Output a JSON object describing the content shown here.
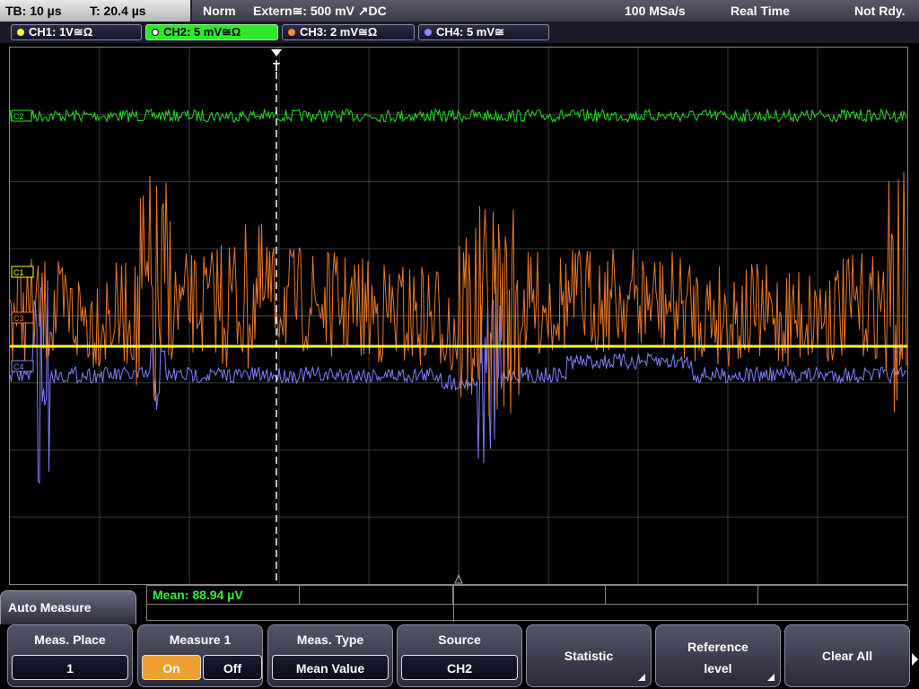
{
  "topbar": {
    "timebase": "TB: 10 µs",
    "trigger_pos": "T: 20.4 µs",
    "mode": "Norm",
    "trigger_source": "Extern≅: 500 mV ↗DC",
    "sample_rate": "100 MSa/s",
    "acq_mode": "Real Time",
    "status": "Not Rdy."
  },
  "channels": [
    {
      "label": "CH1: 1V≅Ω",
      "color": "#ffff33",
      "active": false
    },
    {
      "label": "CH2: 5 mV≅Ω",
      "color": "#33ee33",
      "active": true
    },
    {
      "label": "CH3: 2 mV≅Ω",
      "color": "#ff8c33",
      "active": false
    },
    {
      "label": "CH4: 5 mV≅",
      "color": "#8888ff",
      "active": false
    }
  ],
  "markers": {
    "c1": "C1",
    "c2": "C2",
    "c3": "C3",
    "c4": "C4",
    "trigger": "T"
  },
  "measurement": {
    "result": "Mean: 88.94 µV"
  },
  "menu": {
    "title": "Auto Measure"
  },
  "softkeys": {
    "meas_place": {
      "title": "Meas. Place",
      "value": "1"
    },
    "measure1": {
      "title": "Measure 1",
      "on": "On",
      "off": "Off",
      "state": "On"
    },
    "meas_type": {
      "title": "Meas. Type",
      "value": "Mean Value"
    },
    "source": {
      "title": "Source",
      "value": "CH2"
    },
    "statistic": {
      "label": "Statistic"
    },
    "reference": {
      "line1": "Reference",
      "line2": "level"
    },
    "clear_all": {
      "label": "Clear All"
    }
  }
}
